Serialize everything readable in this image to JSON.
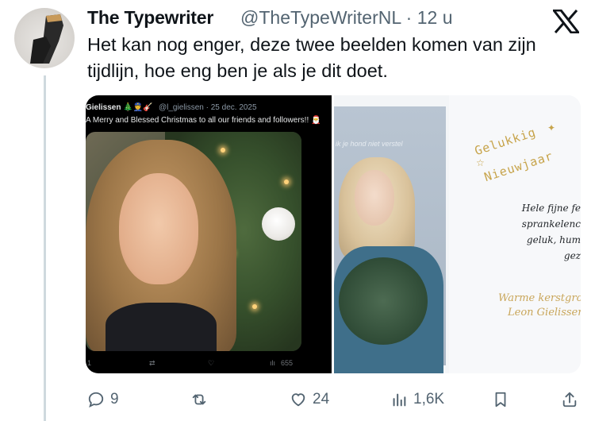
{
  "tweet": {
    "display_name": "The Typewriter",
    "handle_time": "@TheTypeWriterNL · 12 u",
    "text": "Het kan nog enger, deze twee beelden komen van zijn tijdlijn, hoe eng ben je als je dit doet.",
    "logo_icon": "x-logo-icon"
  },
  "embedded_post": {
    "user": "Gielissen 🎄👮🎸",
    "handle_date": "@l_gielissen · 25 dec. 2025",
    "text": "A Merry and Blessed Christmas to all our friends and followers!! 🎅",
    "views": "655",
    "replies": "1"
  },
  "card": {
    "photo_caption": "ik je hond niet verstel",
    "title_line1": "Gelukkig",
    "title_line2": "Nieuwjaar",
    "lines": [
      "Hele fijne fe",
      "sprankelenc",
      "geluk, hum",
      "gez"
    ],
    "sign_line1": "Warme kerstgro",
    "sign_line2": "Leon Gielissen"
  },
  "actions": {
    "replies": "9",
    "reposts": "",
    "likes": "24",
    "views": "1,6K"
  },
  "colors": {
    "text": "#0f1419",
    "muted": "#536471",
    "gold": "#c7a44b"
  }
}
